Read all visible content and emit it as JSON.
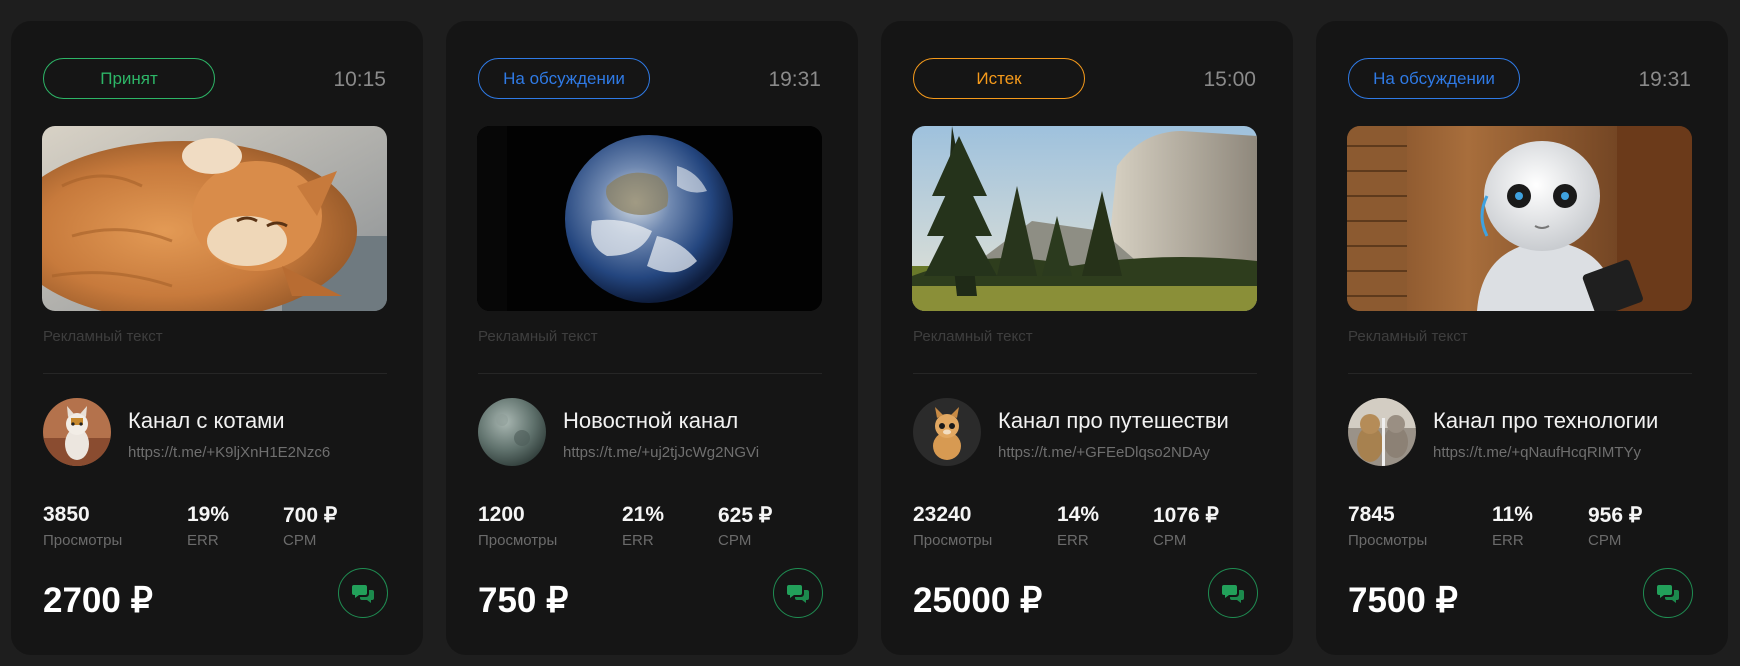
{
  "colors": {
    "page_bg": "#1e1e1e",
    "card_bg": "#151515",
    "accepted": "#2db567",
    "discussion": "#2f7ae5",
    "expired": "#f59a1b",
    "chat_accent": "#22a05a"
  },
  "cards": [
    {
      "status": "Принят",
      "status_color": "#2db567",
      "time": "10:15",
      "image": "orange-cat-photo",
      "ad_text": "Рекламный текст",
      "channel_name": "Канал с котами",
      "channel_link": "https://t.me/+K9ljXnH1E2Nzc6",
      "avatar": "kitten-avatar",
      "stats": [
        {
          "value": "3850",
          "label": "Просмотры"
        },
        {
          "value": "19%",
          "label": "ERR"
        },
        {
          "value": "700 ₽",
          "label": "CPM"
        }
      ],
      "price": "2700 ₽",
      "chat_icon": "chat-bubbles-icon"
    },
    {
      "status": "На обсуждении",
      "status_color": "#2f7ae5",
      "time": "19:31",
      "image": "earth-photo",
      "ad_text": "Рекламный текст",
      "channel_name": "Новостной канал",
      "channel_link": "https://t.me/+uj2tjJcWg2NGVi",
      "avatar": "moon-avatar",
      "stats": [
        {
          "value": "1200",
          "label": "Просмотры"
        },
        {
          "value": "21%",
          "label": "ERR"
        },
        {
          "value": "625 ₽",
          "label": "CPM"
        }
      ],
      "price": "750 ₽",
      "chat_icon": "chat-bubbles-icon"
    },
    {
      "status": "Истек",
      "status_color": "#f59a1b",
      "time": "15:00",
      "image": "mountain-forest-photo",
      "ad_text": "Рекламный текст",
      "channel_name": "Канал про путешестви",
      "channel_link": "https://t.me/+GFEeDlqso2NDAy",
      "avatar": "kitten-avatar",
      "stats": [
        {
          "value": "23240",
          "label": "Просмотры"
        },
        {
          "value": "14%",
          "label": "ERR"
        },
        {
          "value": "1076 ₽",
          "label": "CPM"
        }
      ],
      "price": "25000 ₽",
      "chat_icon": "chat-bubbles-icon"
    },
    {
      "status": "На обсуждении",
      "status_color": "#2f7ae5",
      "time": "19:31",
      "image": "robot-photo",
      "ad_text": "Рекламный текст",
      "channel_name": "Канал про технологии",
      "channel_link": "https://t.me/+qNaufHcqRIMTYy",
      "avatar": "cats-avatar",
      "stats": [
        {
          "value": "7845",
          "label": "Просмотры"
        },
        {
          "value": "11%",
          "label": "ERR"
        },
        {
          "value": "956 ₽",
          "label": "CPM"
        }
      ],
      "price": "7500 ₽",
      "chat_icon": "chat-bubbles-icon"
    }
  ]
}
